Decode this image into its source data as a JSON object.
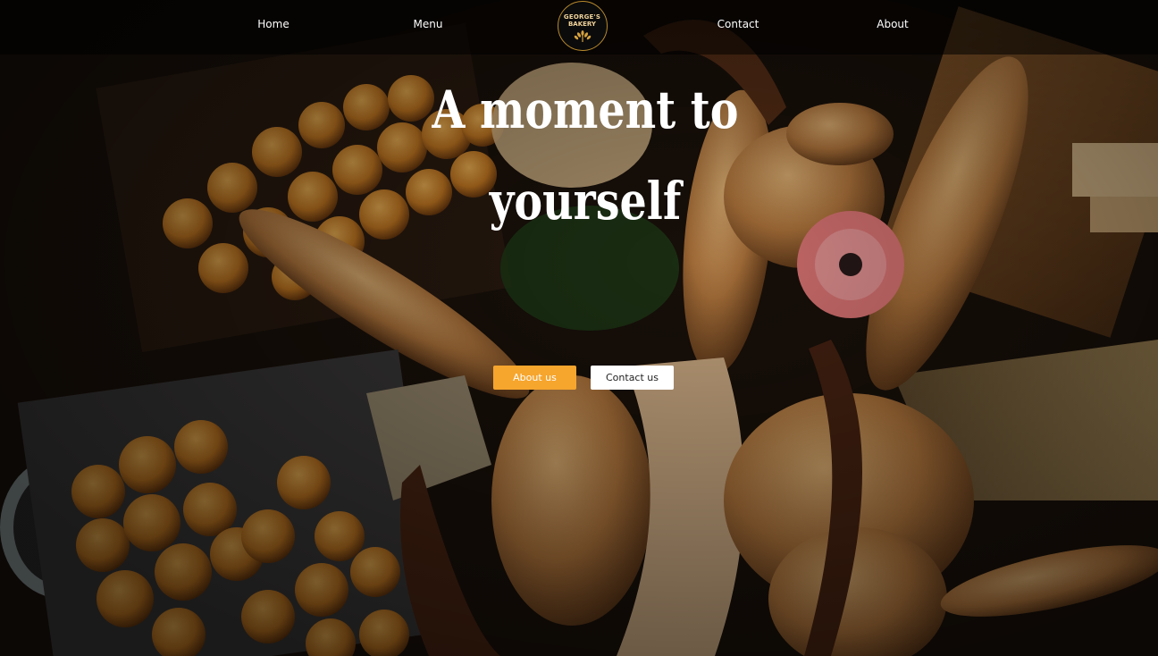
{
  "nav": {
    "items": [
      {
        "label": "Home"
      },
      {
        "label": "Menu"
      },
      {
        "label": "Contact"
      },
      {
        "label": "About"
      }
    ]
  },
  "logo": {
    "line1": "GEORGE'S",
    "line2": "BAKERY",
    "icon": "wheat-icon"
  },
  "hero": {
    "headline_line1": "A moment to",
    "headline_line2": "yourself",
    "background": "bakery-breads-photo"
  },
  "buttons": {
    "about": "About us",
    "contact": "Contact us"
  },
  "colors": {
    "accent": "#f6a52d",
    "nav_bg": "#000000",
    "text": "#ffffff"
  }
}
